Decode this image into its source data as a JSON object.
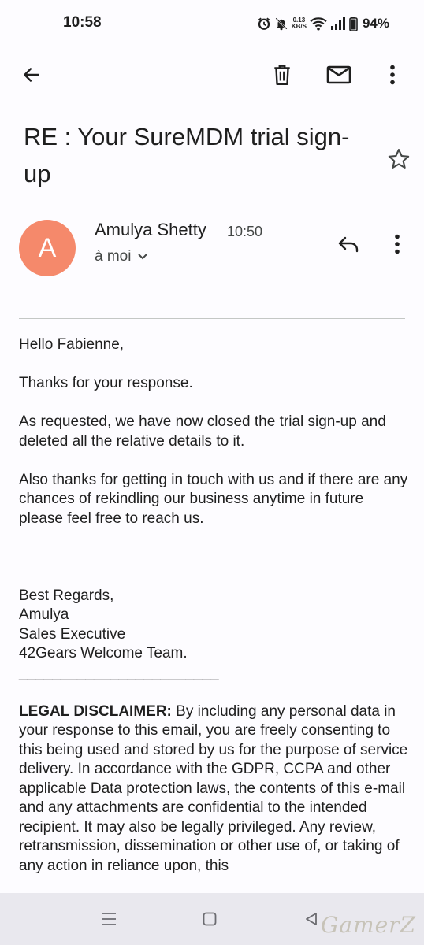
{
  "status_bar": {
    "time": "10:58",
    "speed_value": "0.13",
    "speed_unit": "KB/S",
    "battery": "94%"
  },
  "toolbar": {
    "back_icon": "arrow-back-icon",
    "delete_icon": "trash-icon",
    "mark_unread_icon": "mail-icon",
    "more_icon": "more-vert-icon"
  },
  "email": {
    "subject": "RE : Your SureMDM trial sign-up",
    "sender": {
      "initial": "A",
      "name": "Amulya Shetty",
      "time": "10:50",
      "recipient": "à moi",
      "avatar_color": "#f5896b"
    },
    "body": {
      "greeting": "Hello Fabienne,",
      "p1": "Thanks for your response.",
      "p2": "As requested, we have now closed the trial sign-up and deleted all the relative details to it.",
      "p3": "Also thanks for getting in touch with us and if there are any chances of rekindling our business anytime in future please feel free to reach us.",
      "sign_off": "Best Regards,",
      "sig_name": "Amulya",
      "sig_title": "Sales Executive",
      "sig_team": "42Gears Welcome Team.",
      "sig_rule": "________________________",
      "disclaimer_label": "LEGAL DISCLAIMER:",
      "disclaimer_text": " By including any personal data in your response to this email, you are freely consenting to this being used and stored by us for the purpose of service delivery. In accordance with the GDPR, CCPA and other applicable Data protection laws, the contents of this e-mail and any attachments are confidential to the intended recipient. It may also be legally privileged. Any review, retransmission, dissemination or other use of, or taking of any action in reliance upon, this"
    }
  },
  "watermark": "GamerZ"
}
